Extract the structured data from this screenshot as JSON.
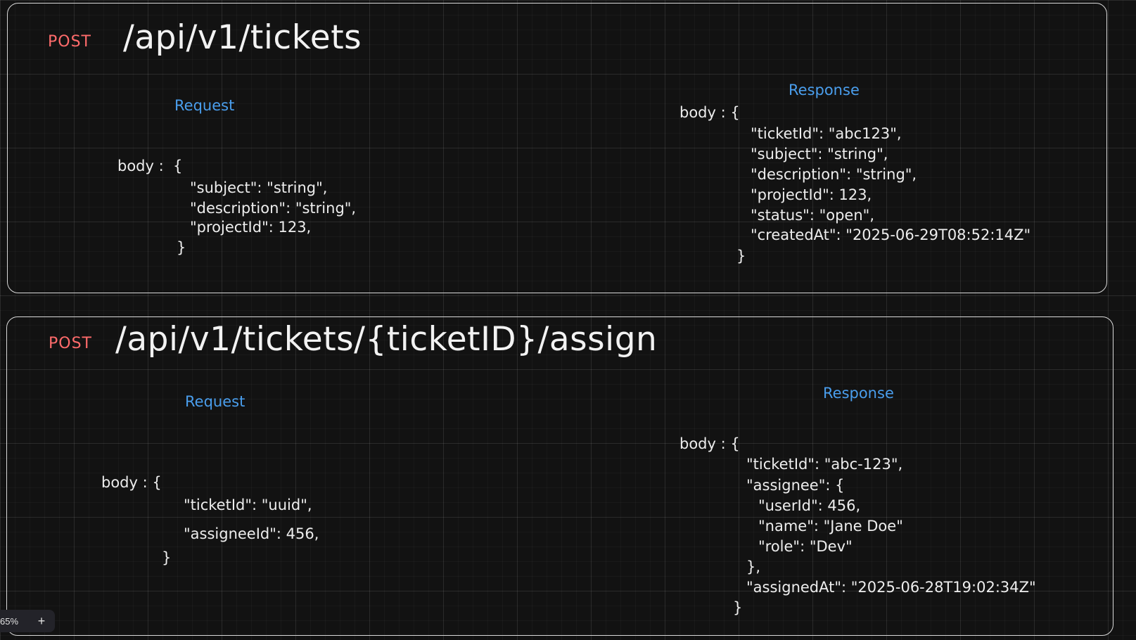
{
  "endpoints": [
    {
      "method": "POST",
      "path": "/api/v1/tickets",
      "request_label": "Request",
      "response_label": "Response",
      "request_lines": [
        "body :  {",
        "\"subject\": \"string\",",
        "\"description\": \"string\",",
        "\"projectId\": 123,",
        "}"
      ],
      "response_lines": [
        "body : {",
        "\"ticketId\": \"abc123\",",
        "\"subject\": \"string\",",
        "\"description\": \"string\",",
        "\"projectId\": 123,",
        "\"status\": \"open\",",
        "\"createdAt\": \"2025-06-29T08:52:14Z\"",
        "}"
      ]
    },
    {
      "method": "POST",
      "path": "/api/v1/tickets/{ticketID}/assign",
      "request_label": "Request",
      "response_label": "Response",
      "request_lines": [
        "body : {",
        "\"ticketId\": \"uuid\",",
        "\"assigneeId\": 456,",
        "}"
      ],
      "response_lines": [
        "body : {",
        "\"ticketId\": \"abc-123\",",
        "\"assignee\": {",
        "\"userId\": 456,",
        "\"name\": \"Jane Doe\"",
        "\"role\": \"Dev\"",
        "},",
        "\"assignedAt\": \"2025-06-28T19:02:34Z\"",
        "}"
      ]
    }
  ],
  "zoom": {
    "level": "65%",
    "plus_icon": "+"
  },
  "colors": {
    "background": "#121212",
    "method": "#ff6b6b",
    "section_label": "#4a9eed",
    "text": "#ededed",
    "border": "#d9d9d9"
  }
}
